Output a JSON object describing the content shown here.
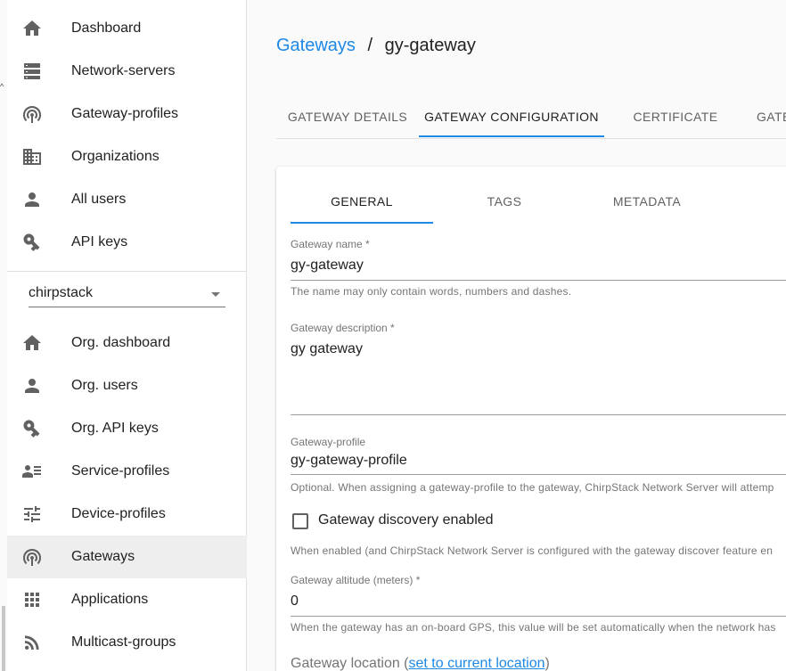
{
  "sidebar": {
    "top_items": [
      {
        "label": "Dashboard",
        "icon": "home-icon"
      },
      {
        "label": "Network-servers",
        "icon": "server-icon"
      },
      {
        "label": "Gateway-profiles",
        "icon": "gateway-icon"
      },
      {
        "label": "Organizations",
        "icon": "building-icon"
      },
      {
        "label": "All users",
        "icon": "user-icon"
      },
      {
        "label": "API keys",
        "icon": "key-icon"
      }
    ],
    "organization_select": {
      "value": "chirpstack"
    },
    "org_items": [
      {
        "label": "Org. dashboard",
        "icon": "home-icon"
      },
      {
        "label": "Org. users",
        "icon": "user-icon"
      },
      {
        "label": "Org. API keys",
        "icon": "key-icon"
      },
      {
        "label": "Service-profiles",
        "icon": "account-details-icon"
      },
      {
        "label": "Device-profiles",
        "icon": "tune-icon"
      },
      {
        "label": "Gateways",
        "icon": "gateway-icon",
        "active": true
      },
      {
        "label": "Applications",
        "icon": "apps-icon"
      },
      {
        "label": "Multicast-groups",
        "icon": "rss-icon"
      }
    ]
  },
  "breadcrumb": {
    "parent": "Gateways",
    "separator": "/",
    "current": "gy-gateway"
  },
  "tabs": [
    {
      "label": "GATEWAY DETAILS"
    },
    {
      "label": "GATEWAY CONFIGURATION",
      "active": true
    },
    {
      "label": "CERTIFICATE"
    },
    {
      "label": "GATE"
    }
  ],
  "subtabs": [
    {
      "label": "GENERAL",
      "active": true
    },
    {
      "label": "TAGS"
    },
    {
      "label": "METADATA"
    }
  ],
  "form": {
    "name": {
      "label": "Gateway name *",
      "value": "gy-gateway",
      "helper": "The name may only contain words, numbers and dashes."
    },
    "description": {
      "label": "Gateway description *",
      "value": "gy gateway"
    },
    "profile": {
      "label": "Gateway-profile",
      "value": "gy-gateway-profile",
      "helper": "Optional. When assigning a gateway-profile to the gateway, ChirpStack Network Server will attemp"
    },
    "discovery": {
      "label": "Gateway discovery enabled",
      "checked": false,
      "helper": "When enabled (and ChirpStack Network Server is configured with the gateway discover feature en"
    },
    "altitude": {
      "label": "Gateway altitude (meters) *",
      "value": "0",
      "helper": "When the gateway has an on-board GPS, this value will be set automatically when the network has"
    },
    "location": {
      "title_prefix": "Gateway location (",
      "link": "set to current location",
      "title_suffix": ")"
    }
  },
  "colors": {
    "accent": "#1e88e5",
    "sidebar_active": "#eeeeee",
    "background": "#fafafa"
  }
}
